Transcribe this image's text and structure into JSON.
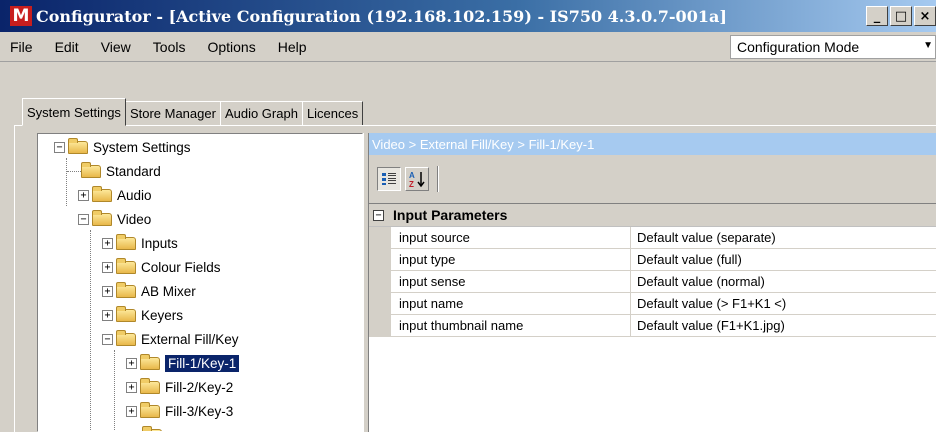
{
  "window": {
    "logo": "M",
    "title": "Configurator - [Active Configuration (192.168.102.159) - IS750 4.3.0.7-001a]",
    "controls": {
      "minimize": "_",
      "maximize": "□",
      "close": "×"
    }
  },
  "menu": {
    "items": [
      "File",
      "Edit",
      "View",
      "Tools",
      "Options",
      "Help"
    ],
    "mode": "Configuration Mode"
  },
  "tabs": [
    "System Settings",
    "Store Manager",
    "Audio Graph",
    "Licences"
  ],
  "active_tab": "System Settings",
  "tree": {
    "root": "System Settings",
    "items": [
      "Standard",
      "Audio",
      "Video",
      "Inputs",
      "Colour Fields",
      "AB Mixer",
      "Keyers",
      "External Fill/Key",
      "Fill-1/Key-1",
      "Fill-2/Key-2",
      "Fill-3/Key-3"
    ],
    "selected": "Fill-1/Key-1"
  },
  "breadcrumb": "Video > External Fill/Key > Fill-1/Key-1",
  "toolbar": {
    "categorized_icon": "categorized-icon",
    "alphabetical_icon": "sort-az-icon",
    "alphabetical_label": "A↓Z"
  },
  "properties": {
    "category": "Input Parameters",
    "rows": [
      {
        "name": "input source",
        "value": "Default value (separate)"
      },
      {
        "name": "input type",
        "value": "Default value (full)"
      },
      {
        "name": "input sense",
        "value": "Default value (normal)"
      },
      {
        "name": "input name",
        "value": "Default value (> F1+K1 <)"
      },
      {
        "name": "input thumbnail name",
        "value": "Default value (F1+K1.jpg)"
      }
    ]
  },
  "colors": {
    "title_start": "#0a246a",
    "title_end": "#a6caf0",
    "selection": "#0a246a",
    "breadcrumb_bg": "#a6caf0",
    "chrome": "#d4d0c8"
  }
}
